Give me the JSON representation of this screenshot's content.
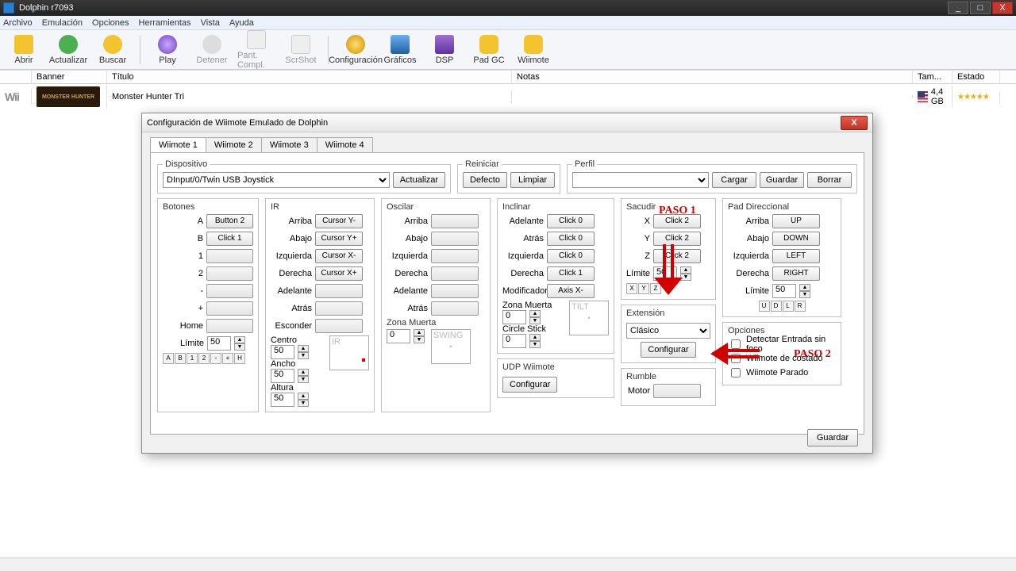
{
  "window": {
    "title": "Dolphin r7093"
  },
  "win_btns": {
    "min": "_",
    "max": "□",
    "close": "X"
  },
  "menu": {
    "archivo": "Archivo",
    "emulacion": "Emulación",
    "opciones": "Opciones",
    "herramientas": "Herramientas",
    "vista": "Vista",
    "ayuda": "Ayuda"
  },
  "toolbar": {
    "abrir": "Abrir",
    "actualizar": "Actualizar",
    "buscar": "Buscar",
    "play": "Play",
    "detener": "Detener",
    "pant": "Pant. Compl.",
    "scrshot": "ScrShot",
    "config": "Configuración",
    "graficos": "Gráficos",
    "dsp": "DSP",
    "padgc": "Pad GC",
    "wiimote": "Wiimote"
  },
  "list": {
    "hdr": {
      "banner": "Banner",
      "titulo": "Título",
      "notas": "Notas",
      "tam": "Tam...",
      "estado": "Estado"
    },
    "row": {
      "type": "Wii",
      "banner": "MONSTER HUNTER",
      "title": "Monster Hunter Tri",
      "size": "4,4 GB",
      "stars": "★★★★★"
    }
  },
  "dialog": {
    "title": "Configuración de Wiimote Emulado de Dolphin",
    "tabs": {
      "t1": "Wiimote 1",
      "t2": "Wiimote 2",
      "t3": "Wiimote 3",
      "t4": "Wiimote 4"
    },
    "dispositivo": {
      "legend": "Dispositivo",
      "value": "DInput/0/Twin USB Joystick",
      "actualizar": "Actualizar"
    },
    "reiniciar": {
      "legend": "Reiniciar",
      "defecto": "Defecto",
      "limpiar": "Limpiar"
    },
    "perfil": {
      "legend": "Perfil",
      "cargar": "Cargar",
      "guardar": "Guardar",
      "borrar": "Borrar"
    },
    "botones": {
      "legend": "Botones",
      "a": "A",
      "a_v": "Button 2",
      "b": "B",
      "b_v": "Click 1",
      "l1": "1",
      "l2": "2",
      "minus": "-",
      "plus": "+",
      "home": "Home",
      "limite": "Límite",
      "limite_v": "50",
      "minitabs": [
        "A",
        "B",
        "1",
        "2",
        "-",
        "+",
        "H"
      ]
    },
    "ir": {
      "legend": "IR",
      "arriba": "Arriba",
      "arriba_v": "Cursor Y-",
      "abajo": "Abajo",
      "abajo_v": "Cursor Y+",
      "izq": "Izquierda",
      "izq_v": "Cursor X-",
      "der": "Derecha",
      "der_v": "Cursor X+",
      "adelante": "Adelante",
      "atras": "Atrás",
      "esconder": "Esconder",
      "centro": "Centro",
      "centro_v": "50",
      "ancho": "Ancho",
      "ancho_v": "50",
      "altura": "Altura",
      "altura_v": "50",
      "preview": "IR"
    },
    "oscilar": {
      "legend": "Oscilar",
      "arriba": "Arriba",
      "abajo": "Abajo",
      "izq": "Izquierda",
      "der": "Derecha",
      "adelante": "Adelante",
      "atras": "Atrás",
      "zonamuerta": "Zona Muerta",
      "zm_v": "0",
      "preview": "SWING"
    },
    "inclinar": {
      "legend": "Inclinar",
      "adelante": "Adelante",
      "ad_v": "Click 0",
      "atras": "Atrás",
      "at_v": "Click 0",
      "izq": "Izquierda",
      "iz_v": "Click 0",
      "der": "Derecha",
      "de_v": "Click 1",
      "mod": "Modificador",
      "mod_v": "Axis X-",
      "zonamuerta": "Zona Muerta",
      "zm_v": "0",
      "circle": "Circle Stick",
      "cs_v": "0",
      "preview": "TILT"
    },
    "udp": {
      "legend": "UDP Wiimote",
      "configurar": "Configurar"
    },
    "sacudir": {
      "legend": "Sacudir",
      "x": "X",
      "x_v": "Click 2",
      "y": "Y",
      "y_v": "Click 2",
      "z": "Z",
      "z_v": "Click 2",
      "limite": "Límite",
      "limite_v": "50",
      "minitabs": [
        "X",
        "Y",
        "Z"
      ]
    },
    "extension": {
      "legend": "Extensión",
      "value": "Clásico",
      "configurar": "Configurar"
    },
    "rumble": {
      "legend": "Rumble",
      "motor": "Motor"
    },
    "dpad": {
      "legend": "Pad Direccional",
      "arriba": "Arriba",
      "up": "UP",
      "abajo": "Abajo",
      "down": "DOWN",
      "izq": "Izquierda",
      "left": "LEFT",
      "der": "Derecha",
      "right": "RIGHT",
      "limite": "Límite",
      "limite_v": "50",
      "minitabs": [
        "U",
        "D",
        "L",
        "R"
      ]
    },
    "opciones": {
      "legend": "Opciones",
      "c1": "Detectar Entrada sin foco",
      "c2": "Wiimote de costado",
      "c3": "Wiimote Parado"
    },
    "guardar": "Guardar"
  },
  "anno": {
    "paso1": "PASO 1",
    "paso2": "PASO 2"
  }
}
